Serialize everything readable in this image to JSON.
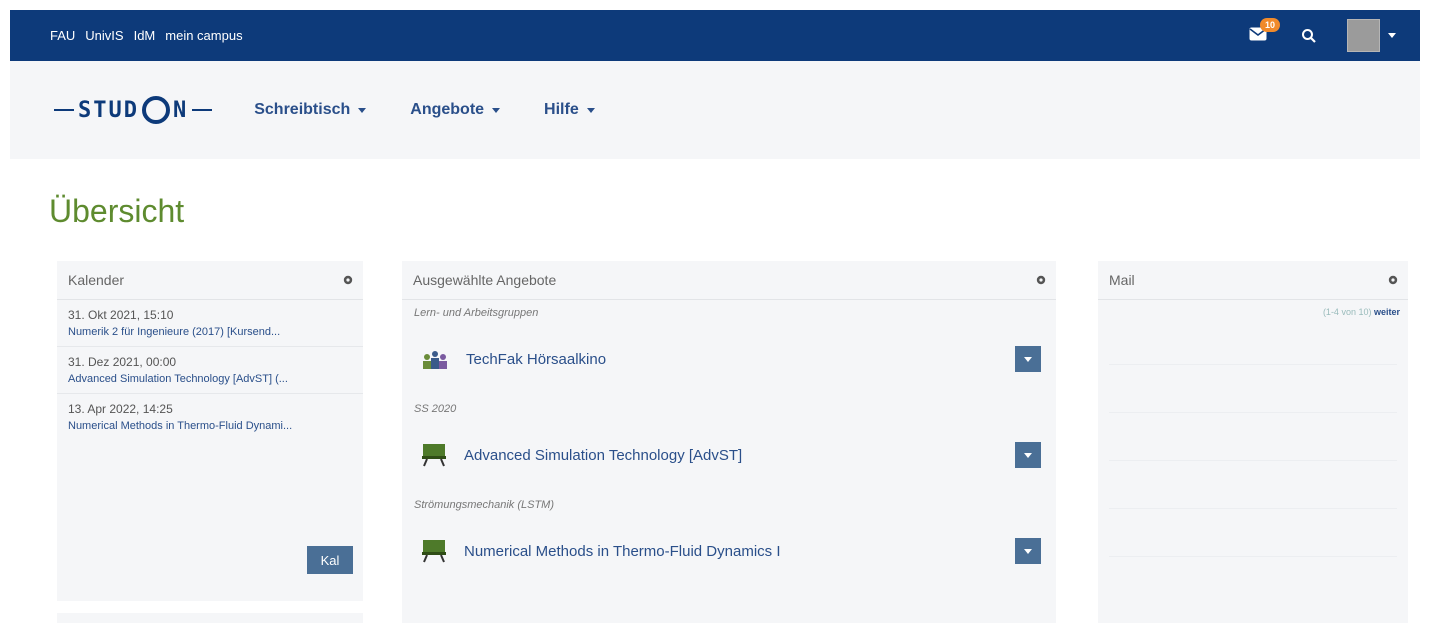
{
  "topbar": {
    "links": [
      "FAU",
      "UnivIS",
      "IdM",
      "mein campus"
    ],
    "mail_badge": "10"
  },
  "nav": {
    "logo_left": "STUD",
    "logo_right": "N",
    "items": [
      "Schreibtisch",
      "Angebote",
      "Hilfe"
    ]
  },
  "page": {
    "title": "Übersicht"
  },
  "calendar": {
    "title": "Kalender",
    "entries": [
      {
        "date": "31. Okt 2021, 15:10",
        "link": "Numerik 2 für Ingenieure (2017) [Kursend..."
      },
      {
        "date": "31. Dez 2021, 00:00",
        "link": "Advanced Simulation Technology [AdvST] (..."
      },
      {
        "date": "13. Apr 2022, 14:25",
        "link": "Numerical Methods in Thermo-Fluid Dynami..."
      }
    ],
    "button": "Kal"
  },
  "selected": {
    "title": "Ausgewählte Angebote",
    "groups": [
      {
        "heading": "Lern- und Arbeitsgruppen",
        "item": "TechFak Hörsaalkino",
        "icon": "group-icon"
      },
      {
        "heading": "SS 2020",
        "item": "Advanced Simulation Technology [AdvST]",
        "icon": "course-icon"
      },
      {
        "heading": "Strömungsmechanik (LSTM)",
        "item": "Numerical Methods in Thermo-Fluid Dynamics I",
        "icon": "course-icon"
      }
    ]
  },
  "mail": {
    "title": "Mail",
    "count": "(1-4 von 10)",
    "more": "weiter"
  },
  "colors": {
    "topbar": "#0d3a7a",
    "title_green": "#5e8b2f",
    "button_blue": "#4a6f96",
    "badge_orange": "#f08a2b"
  }
}
